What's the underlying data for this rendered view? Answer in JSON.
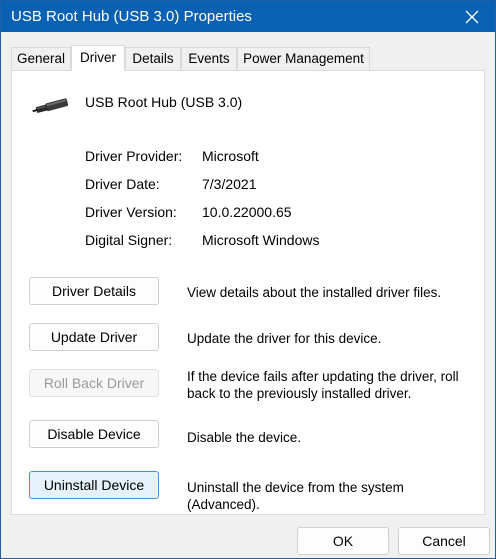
{
  "window": {
    "title": "USB Root Hub (USB 3.0) Properties",
    "accent_color": "#0a61b4"
  },
  "tabs": [
    {
      "label": "General"
    },
    {
      "label": "Driver",
      "active": true
    },
    {
      "label": "Details"
    },
    {
      "label": "Events"
    },
    {
      "label": "Power Management"
    }
  ],
  "device": {
    "icon": "usb-plug-icon",
    "name": "USB Root Hub (USB 3.0)"
  },
  "properties": [
    {
      "label": "Driver Provider:",
      "value": "Microsoft"
    },
    {
      "label": "Driver Date:",
      "value": "7/3/2021"
    },
    {
      "label": "Driver Version:",
      "value": "10.0.22000.65"
    },
    {
      "label": "Digital Signer:",
      "value": "Microsoft Windows"
    }
  ],
  "actions": [
    {
      "label": "Driver Details",
      "description": "View details about the installed driver files.",
      "enabled": true
    },
    {
      "label": "Update Driver",
      "description": "Update the driver for this device.",
      "enabled": true
    },
    {
      "label": "Roll Back Driver",
      "description": "If the device fails after updating the driver, roll back to the previously installed driver.",
      "enabled": false
    },
    {
      "label": "Disable Device",
      "description": "Disable the device.",
      "enabled": true
    },
    {
      "label": "Uninstall Device",
      "description": "Uninstall the device from the system (Advanced).",
      "enabled": true,
      "focused": true
    }
  ],
  "footer": {
    "ok_label": "OK",
    "cancel_label": "Cancel"
  }
}
